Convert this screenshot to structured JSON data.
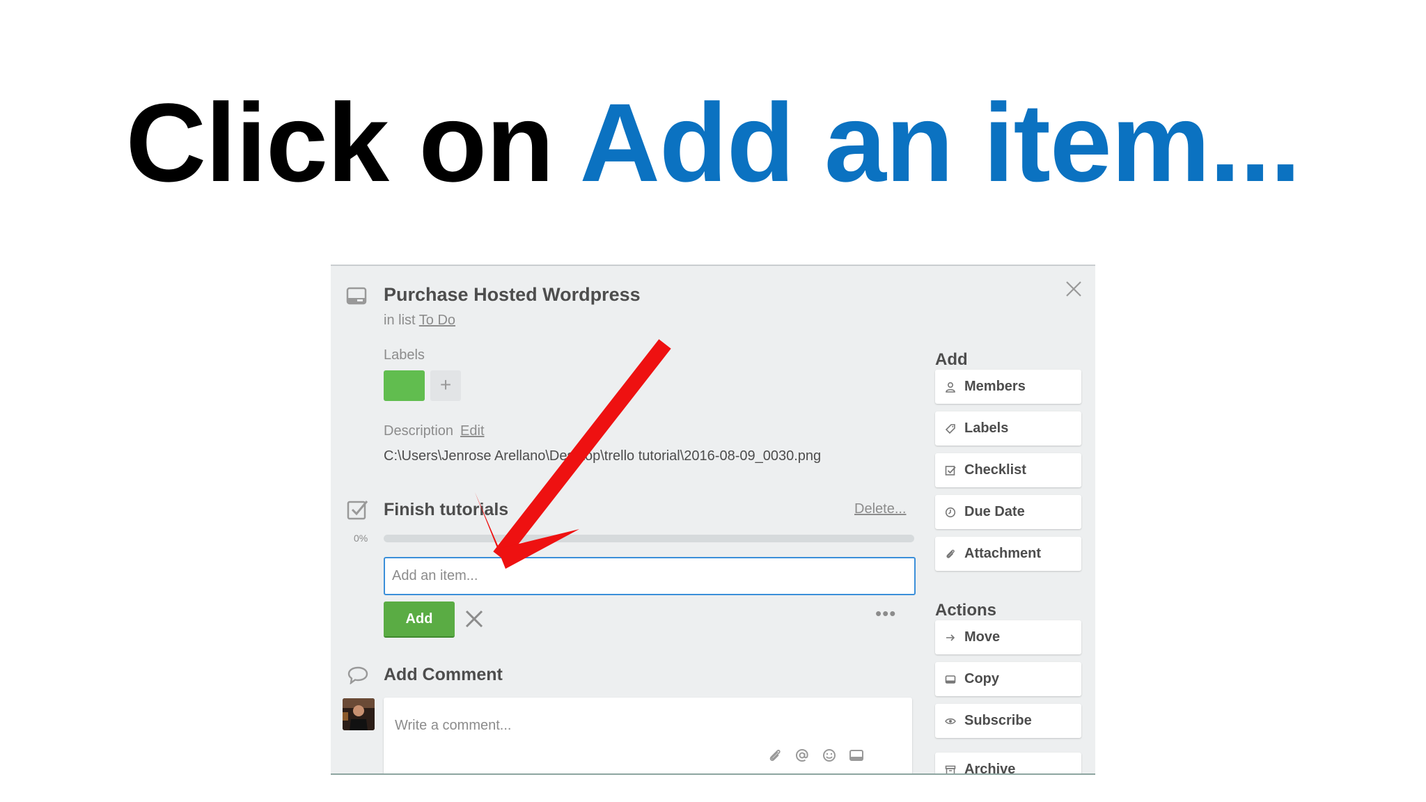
{
  "slide": {
    "title_prefix": "Click on ",
    "title_highlight": "Add an item..."
  },
  "card": {
    "title": "Purchase Hosted Wordpress",
    "in_list_prefix": "in list ",
    "list_name": "To Do",
    "labels_heading": "Labels",
    "label_add_symbol": "+",
    "label_color": "#61bd4f",
    "description_heading": "Description",
    "description_edit": "Edit",
    "description_text": "C:\\Users\\Jenrose Arellano\\Desktop\\trello tutorial\\2016-08-09_0030.png"
  },
  "checklist": {
    "title": "Finish tutorials",
    "delete_label": "Delete...",
    "progress_label": "0%",
    "progress_percent": 0,
    "add_item_placeholder": "Add an item...",
    "add_button": "Add",
    "more_label": "•••"
  },
  "comment": {
    "heading": "Add Comment",
    "placeholder": "Write a comment..."
  },
  "sidebar": {
    "add_heading": "Add",
    "add_items": [
      {
        "label": "Members",
        "icon": "person-icon"
      },
      {
        "label": "Labels",
        "icon": "tag-icon"
      },
      {
        "label": "Checklist",
        "icon": "checkbox-icon"
      },
      {
        "label": "Due Date",
        "icon": "clock-icon"
      },
      {
        "label": "Attachment",
        "icon": "paperclip-icon"
      }
    ],
    "actions_heading": "Actions",
    "action_items": [
      {
        "label": "Move",
        "icon": "arrow-right-icon"
      },
      {
        "label": "Copy",
        "icon": "card-icon"
      },
      {
        "label": "Subscribe",
        "icon": "eye-icon"
      },
      {
        "label": "Archive",
        "icon": "archive-icon"
      }
    ]
  },
  "colors": {
    "title_accent": "#0b72c1",
    "add_button": "#5aac44",
    "input_focus": "#3b8fd9",
    "annotation_arrow": "#ee1111"
  }
}
